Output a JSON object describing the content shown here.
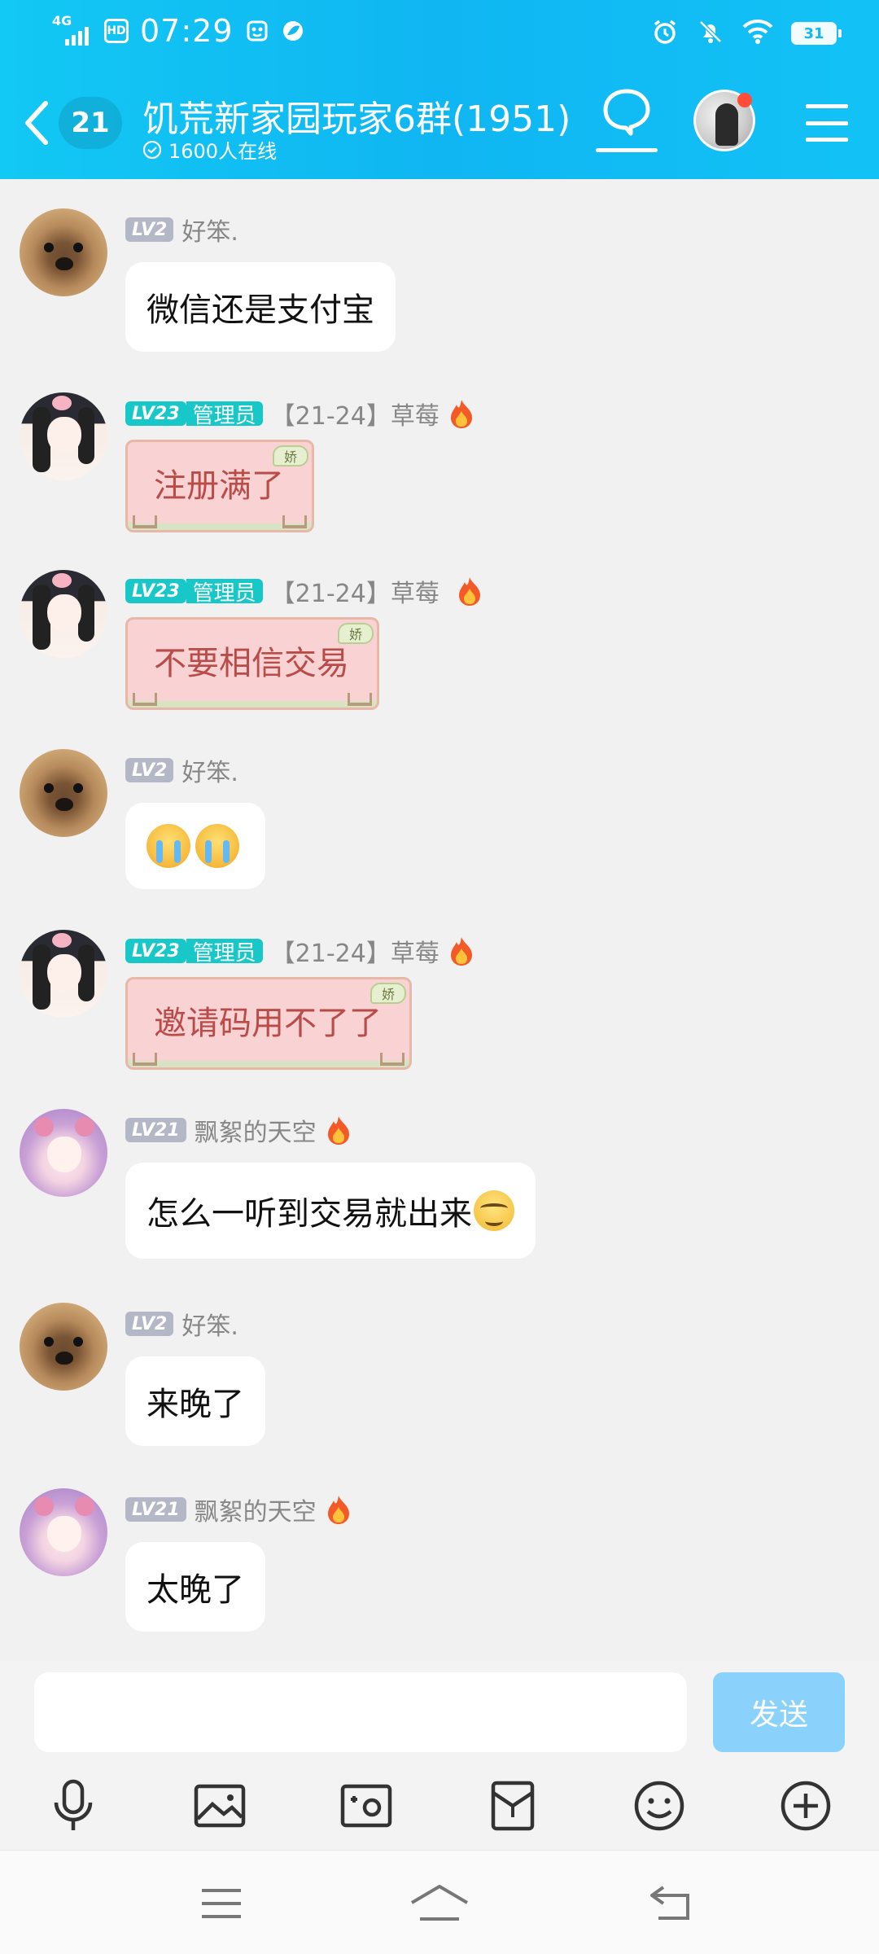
{
  "status_bar": {
    "network": "4G",
    "hd": "HD",
    "time": "07:29",
    "battery": "31"
  },
  "header": {
    "unread_count": "21",
    "title": "饥荒新家园玩家6群(1951)",
    "online": "1600人在线"
  },
  "messages": [
    {
      "avatar": "dog",
      "level": "LV2",
      "role": "",
      "tag": "",
      "nick": "好笨.",
      "flame": false,
      "type": "text",
      "text": "微信还是支付宝"
    },
    {
      "avatar": "anime",
      "level": "LV23",
      "role": "管理员",
      "tag": "【21-24】",
      "nick": "草莓",
      "flame": true,
      "type": "decorated",
      "text": "注册满了",
      "badge": "娇"
    },
    {
      "avatar": "anime",
      "level": "LV23",
      "role": "管理员",
      "tag": "【21-24】",
      "nick": "草莓",
      "flame": true,
      "type": "decorated",
      "text": "不要相信交易",
      "badge": "娇"
    },
    {
      "avatar": "dog",
      "level": "LV2",
      "role": "",
      "tag": "",
      "nick": "好笨.",
      "flame": false,
      "type": "emoji",
      "emojis": [
        "crying-face",
        "crying-face"
      ]
    },
    {
      "avatar": "anime",
      "level": "LV23",
      "role": "管理员",
      "tag": "【21-24】",
      "nick": "草莓",
      "flame": true,
      "type": "decorated",
      "text": "邀请码用不了了",
      "badge": "娇"
    },
    {
      "avatar": "purple",
      "level": "LV21",
      "role": "",
      "tag": "",
      "nick": "飘絮的天空",
      "flame": true,
      "type": "text",
      "text": "怎么一听到交易就出来",
      "trailing_emoji": "smirk-face"
    },
    {
      "avatar": "dog",
      "level": "LV2",
      "role": "",
      "tag": "",
      "nick": "好笨.",
      "flame": false,
      "type": "text",
      "text": "来晚了"
    },
    {
      "avatar": "purple",
      "level": "LV21",
      "role": "",
      "tag": "",
      "nick": "飘絮的天空",
      "flame": true,
      "type": "text",
      "text": "太晚了"
    }
  ],
  "input": {
    "value": "",
    "placeholder": "",
    "send_label": "发送"
  },
  "toolbar_icons": [
    "microphone-icon",
    "picture-icon",
    "camera-icon",
    "red-packet-icon",
    "emoji-icon",
    "plus-icon"
  ],
  "colors": {
    "header": "#10b6f2",
    "admin_badge": "#18c8c8",
    "send_button": "#8ad1fb",
    "background": "#f1f1f1"
  }
}
